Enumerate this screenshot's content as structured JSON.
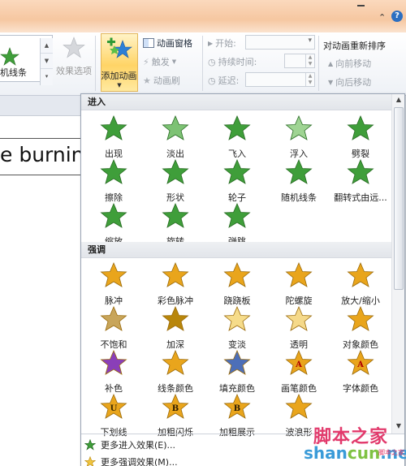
{
  "ribbon": {
    "gallery_label": "机线条",
    "effect_options": "效果选项",
    "add_animation": "添加动画",
    "animation_pane": "动画窗格",
    "trigger": "触发",
    "animation_painter": "动画刷",
    "start_label": "开始:",
    "duration_label": "持续时间:",
    "delay_label": "延迟:",
    "reorder_title": "对动画重新排序",
    "move_earlier": "向前移动",
    "move_later": "向后移动"
  },
  "slide": {
    "text": "e burnin"
  },
  "dropdown": {
    "entrance": {
      "heading": "进入",
      "items": [
        {
          "label": "出现",
          "icon": "appear-icon"
        },
        {
          "label": "淡出",
          "icon": "fade-icon"
        },
        {
          "label": "飞入",
          "icon": "fly-in-icon"
        },
        {
          "label": "浮入",
          "icon": "float-in-icon"
        },
        {
          "label": "劈裂",
          "icon": "split-icon"
        },
        {
          "label": "擦除",
          "icon": "wipe-icon"
        },
        {
          "label": "形状",
          "icon": "shape-icon"
        },
        {
          "label": "轮子",
          "icon": "wheel-icon"
        },
        {
          "label": "随机线条",
          "icon": "random-bars-icon"
        },
        {
          "label": "翻转式由远...",
          "icon": "grow-turn-icon"
        },
        {
          "label": "缩放",
          "icon": "zoom-icon"
        },
        {
          "label": "旋转",
          "icon": "swivel-icon"
        },
        {
          "label": "弹跳",
          "icon": "bounce-icon"
        }
      ]
    },
    "emphasis": {
      "heading": "强调",
      "items": [
        {
          "label": "脉冲",
          "icon": "pulse-icon"
        },
        {
          "label": "彩色脉冲",
          "icon": "color-pulse-icon"
        },
        {
          "label": "跷跷板",
          "icon": "teeter-icon"
        },
        {
          "label": "陀螺旋",
          "icon": "spin-icon"
        },
        {
          "label": "放大/缩小",
          "icon": "grow-shrink-icon"
        },
        {
          "label": "不饱和",
          "icon": "desaturate-icon"
        },
        {
          "label": "加深",
          "icon": "darken-icon"
        },
        {
          "label": "变淡",
          "icon": "lighten-icon"
        },
        {
          "label": "透明",
          "icon": "transparency-icon"
        },
        {
          "label": "对象颜色",
          "icon": "object-color-icon"
        },
        {
          "label": "补色",
          "icon": "complementary-color-icon"
        },
        {
          "label": "线条颜色",
          "icon": "line-color-icon"
        },
        {
          "label": "填充颜色",
          "icon": "fill-color-icon"
        },
        {
          "label": "画笔颜色",
          "icon": "brush-color-icon"
        },
        {
          "label": "字体颜色",
          "icon": "font-color-icon"
        },
        {
          "label": "下划线",
          "icon": "underline-icon"
        },
        {
          "label": "加粗闪烁",
          "icon": "bold-flash-icon"
        },
        {
          "label": "加粗展示",
          "icon": "bold-reveal-icon"
        },
        {
          "label": "波浪形",
          "icon": "wave-icon"
        }
      ]
    },
    "more_entrance": "更多进入效果(E)...",
    "more_emphasis": "更多强调效果(M)..."
  },
  "watermark": {
    "cn": "脚本之家",
    "en_a": "shan",
    "en_b": "cun",
    "en_c": ".net",
    "small": "脚本之家"
  },
  "colors": {
    "entrance_green": "#3f9e3a",
    "emphasis_gold": "#e9a51c",
    "highlight": "#ffd466"
  }
}
